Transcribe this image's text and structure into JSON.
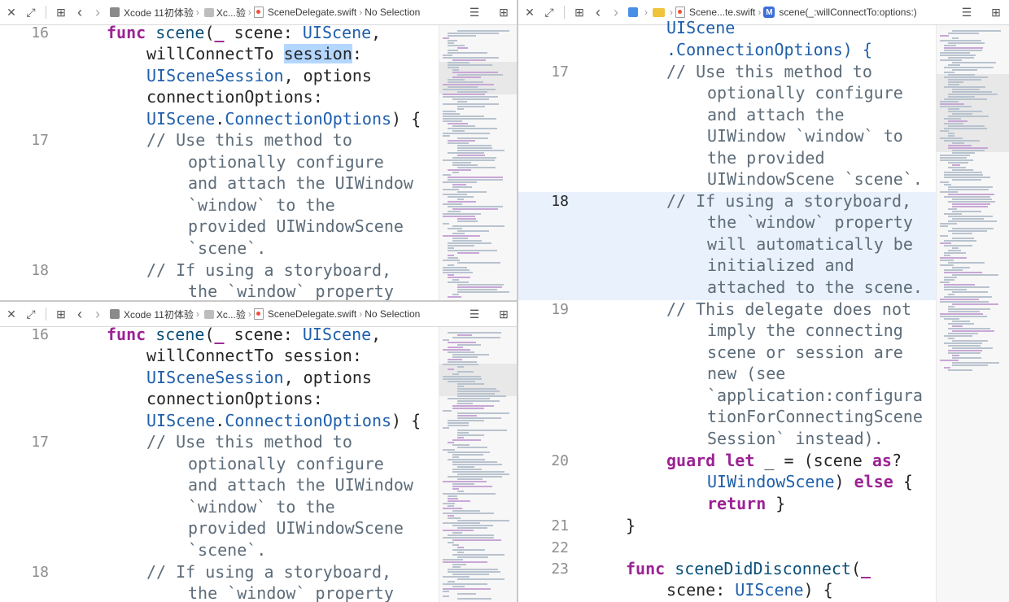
{
  "left_top": {
    "breadcrumb": {
      "project": "Xcode 11初体验",
      "group": "Xc...验",
      "file": "SceneDelegate.swift",
      "selection": "No Selection"
    },
    "line_numbers": [
      "16",
      "17",
      "18"
    ]
  },
  "left_bottom": {
    "breadcrumb": {
      "project": "Xcode 11初体验",
      "group": "Xc...验",
      "file": "SceneDelegate.swift",
      "selection": "No Selection"
    },
    "line_numbers": [
      "16",
      "17",
      "18"
    ]
  },
  "right": {
    "breadcrumb": {
      "file": "Scene...te.swift",
      "method_badge": "M",
      "method": "scene(_:willConnectTo:options:)"
    },
    "line_numbers": [
      "17",
      "18",
      "19",
      "20",
      "21",
      "22",
      "23"
    ]
  },
  "code": {
    "func": "func",
    "scene_fn": "scene",
    "paren_open": "(",
    "underscore": "_",
    "scene_param": " scene: ",
    "UIScene": "UIScene",
    "comma": ",",
    "willConnectTo": "willConnectTo ",
    "session": "session",
    "colon": ":",
    "UISceneSession": "UISceneSession",
    "options_tail": ", options",
    "connectionOptions": "connectionOptions:",
    "dot": ".",
    "ConnectionOptions": "ConnectionOptions",
    "close_brace_open": ") {",
    "c17_1": "// Use this method to",
    "c17_2": "optionally configure",
    "c17_3": "and attach the UIWindow",
    "c17_4": "`window` to the",
    "c17_5": "provided UIWindowScene",
    "c17_6": "`scene`.",
    "c18_1": "// If using a storyboard,",
    "c18_2": "the `window` property",
    "r_uiscene": "UIScene",
    "r_conn": ".ConnectionOptions) {",
    "r17_1": "// Use this method to",
    "r17_2": "optionally configure",
    "r17_3": "and attach the",
    "r17_4": "UIWindow `window` to",
    "r17_5": "the provided",
    "r17_6": "UIWindowScene `scene`.",
    "r18_1": "// If using a storyboard,",
    "r18_2": "the `window` property",
    "r18_3": "will automatically be",
    "r18_4": "initialized and",
    "r18_5": "attached to the scene.",
    "r19_1": "// This delegate does not",
    "r19_2": "imply the connecting",
    "r19_3": "scene or session are",
    "r19_4": "new (see",
    "r19_5": "`application:configura",
    "r19_6": "tionForConnectingScene",
    "r19_7": "Session` instead).",
    "guard": "guard",
    "let": "let",
    "guard_mid": " _ = (scene ",
    "as": "as",
    "q": "?",
    "UIWindowScene": "UIWindowScene",
    "paren_close": ") ",
    "else": "else",
    "brace": " {",
    "return": "return",
    "return_tail": " }",
    "close": "}",
    "sceneDidDisconnect": "sceneDidDisconnect",
    "open_paren": "(",
    "r23_2_pre": "scene: ",
    "r23_2_post": ") {"
  }
}
